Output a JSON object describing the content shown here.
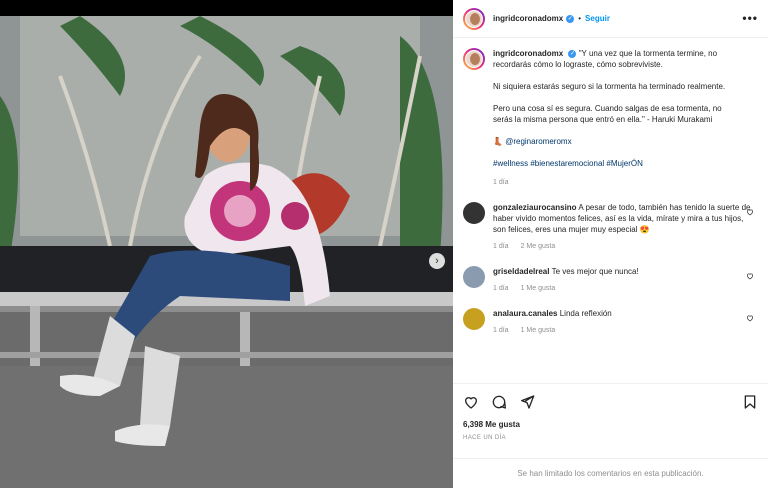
{
  "post": {
    "username": "ingridcoronadomx",
    "follow_label": "Seguir",
    "more_label": "•••",
    "caption": {
      "p1": "\"Y una vez que la tormenta termine, no recordarás cómo lo lograste, cómo sobreviviste.",
      "p2": "Ni siquiera estarás seguro si la tormenta ha terminado realmente.",
      "p3": "Pero una cosa sí es segura. Cuando salgas de esa tormenta, no serás la misma persona que entró en ella.\" - Haruki Murakami",
      "credit_emoji": "👢",
      "credit_mention": "@reginaromeromx",
      "hashtags": "#wellness #bienestaremocional #MujerÓN",
      "time": "1 día"
    }
  },
  "comments": [
    {
      "user": "gonzaleziaurocansino",
      "text": "A pesar de todo, también has tenido la suerte de haber vivido momentos felices, así es la vida, mírate y mira a tus hijos, son felices, eres una mujer muy especial 😍",
      "time": "1 día",
      "likes": "2 Me gusta"
    },
    {
      "user": "griseldadelreal",
      "text": "Te ves mejor que nunca!",
      "time": "1 día",
      "likes": "1 Me gusta"
    },
    {
      "user": "analaura.canales",
      "text": "Linda reflexión",
      "time": "1 día",
      "likes": "1 Me gusta"
    }
  ],
  "footer": {
    "likes": "6,398 Me gusta",
    "ago": "HACE UN DÍA",
    "disabled": "Se han limitado los comentarios en esta publicación."
  },
  "icons": [
    "heart-icon",
    "comment-icon",
    "share-icon",
    "bookmark-icon",
    "chevron-right-icon"
  ]
}
